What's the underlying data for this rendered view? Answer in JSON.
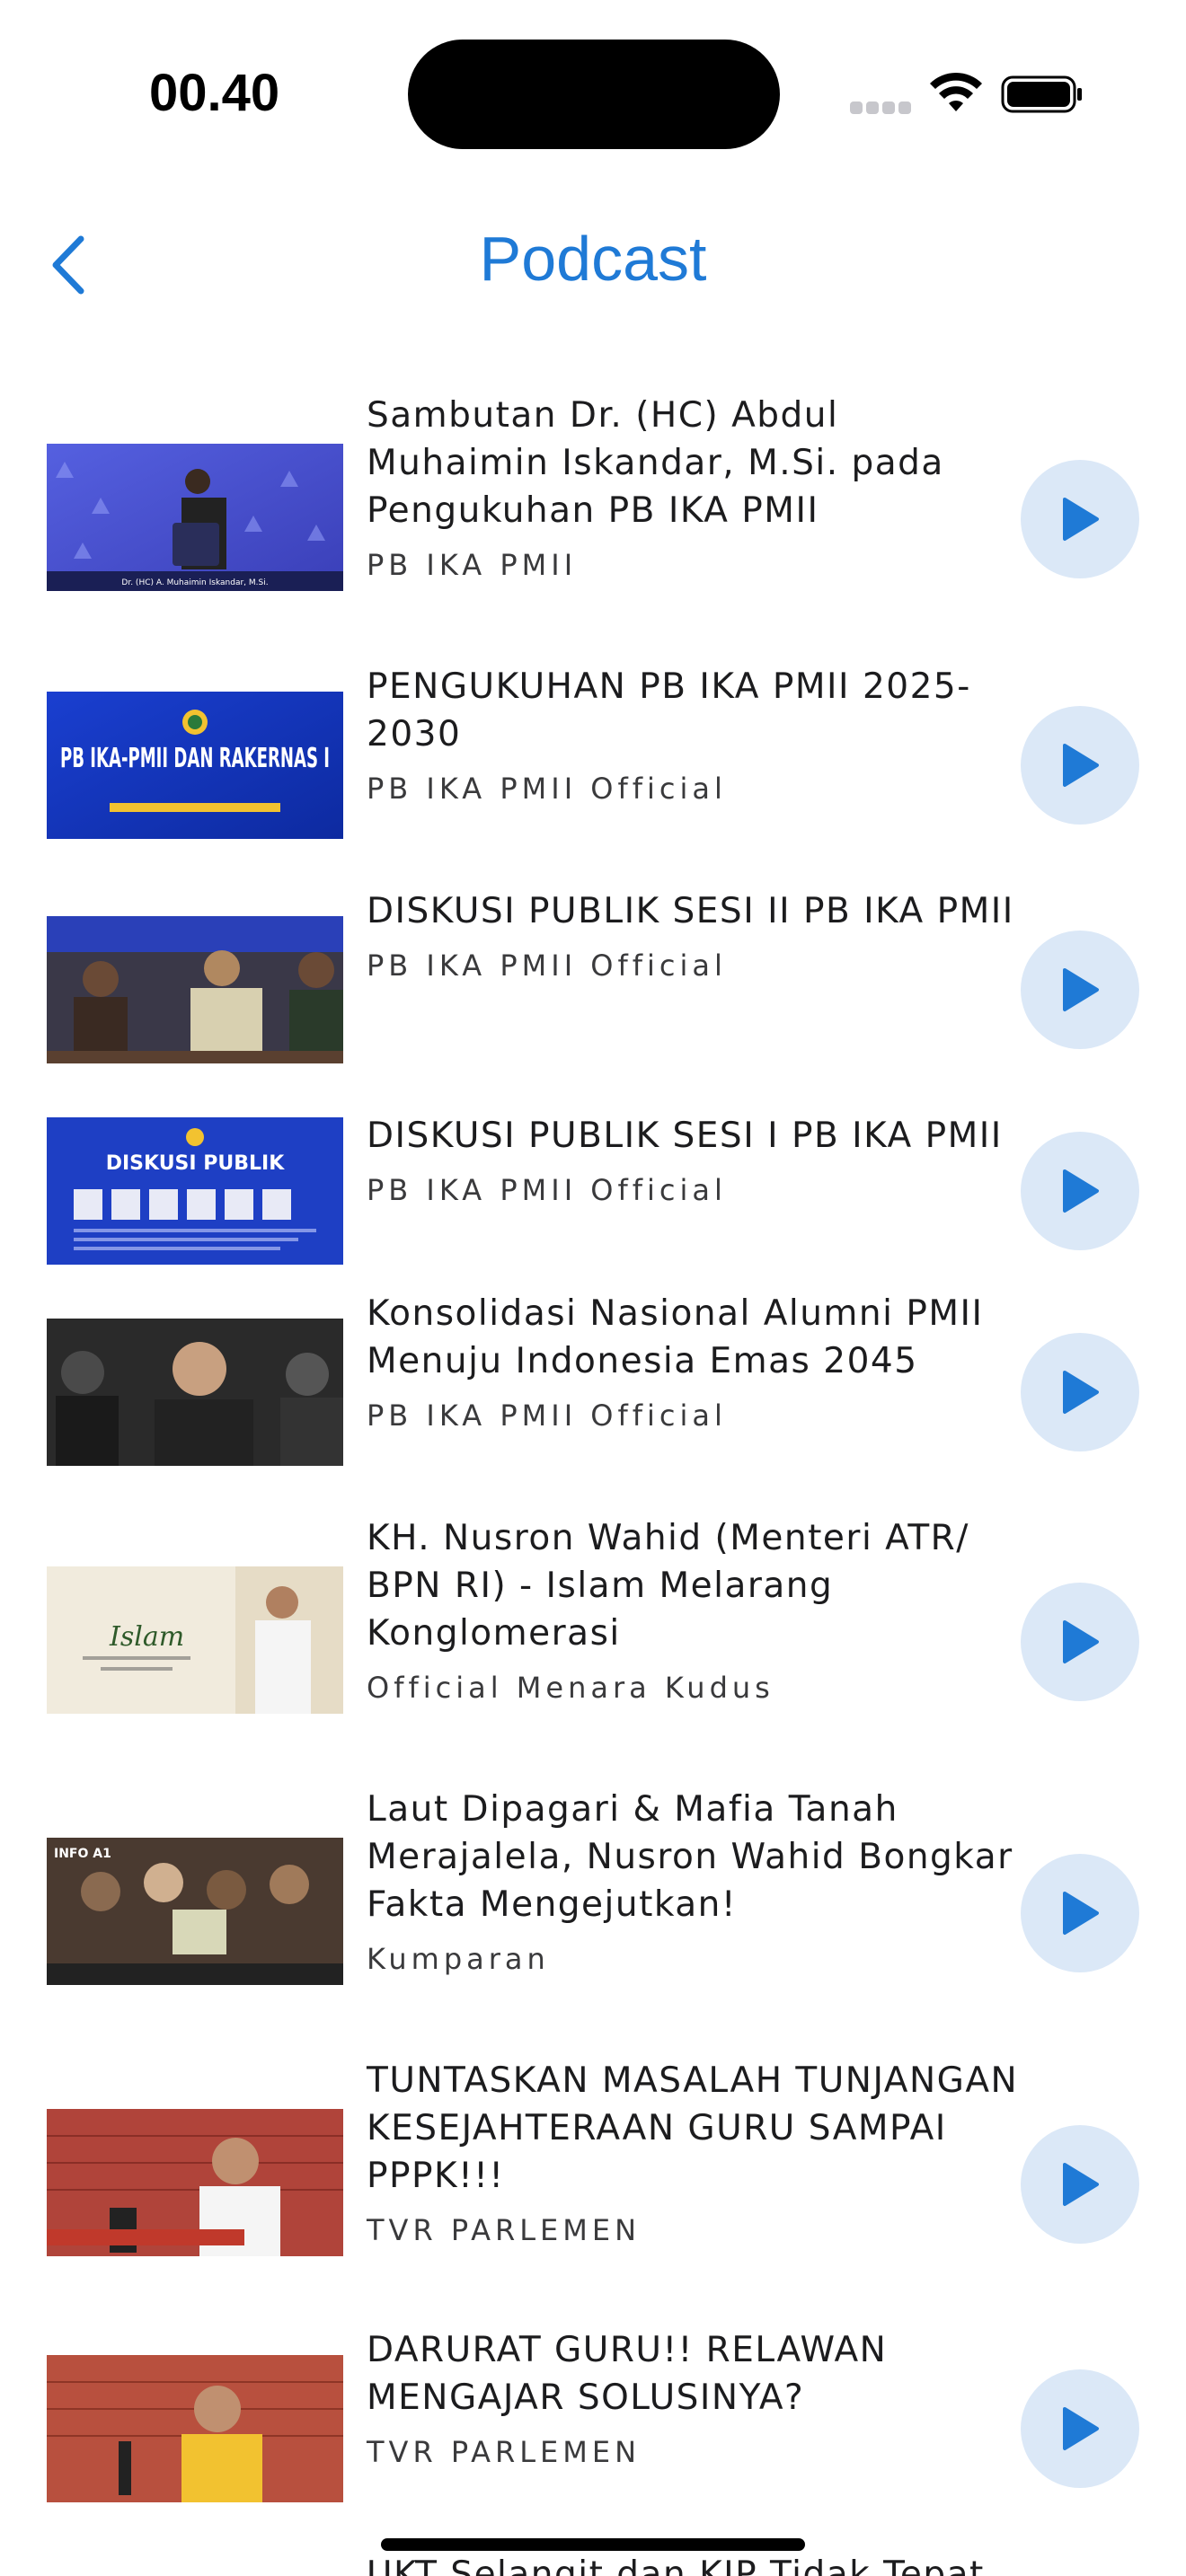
{
  "status_bar": {
    "time": "00.40"
  },
  "nav": {
    "title": "Podcast"
  },
  "colors": {
    "accent": "#1f7ad6",
    "play_bg": "#dbe8f7"
  },
  "icons": {
    "back": "chevron-left-icon",
    "play": "play-icon",
    "wifi": "wifi-icon",
    "battery": "battery-icon",
    "signal": "cellular-signal-icon"
  },
  "podcasts": [
    {
      "title": "Sambutan Dr. (HC) Abdul Muhaimin Iskandar, M.Si. pada Pengukuhan PB IKA PMII",
      "channel": "PB IKA PMII",
      "thumb_overlay": "Dr. (HC) A. Muhaimin Iskandar, M.Si."
    },
    {
      "title": "PENGUKUHAN PB IKA PMII 2025-2030",
      "channel": "PB IKA PMII Official",
      "thumb_overlay": "PB IKA-PMII DAN RAKERNAS I"
    },
    {
      "title": "DISKUSI PUBLIK SESI II PB IKA PMII",
      "channel": "PB IKA PMII Official",
      "thumb_overlay": ""
    },
    {
      "title": "DISKUSI PUBLIK SESI I PB IKA PMII",
      "channel": "PB IKA PMII Official",
      "thumb_overlay": "DISKUSI PUBLIK"
    },
    {
      "title": "Konsolidasi Nasional Alumni PMII Menuju Indonesia Emas 2045",
      "channel": "PB IKA PMII Official",
      "thumb_overlay": ""
    },
    {
      "title": "KH. Nusron Wahid (Menteri ATR/ BPN RI) - Islam Melarang Konglomerasi",
      "channel": "Official Menara Kudus",
      "thumb_overlay": "Islam"
    },
    {
      "title": "Laut Dipagari & Mafia Tanah Merajalela, Nusron Wahid Bongkar Fakta Mengejutkan!",
      "channel": "Kumparan",
      "thumb_overlay": "INFO A1"
    },
    {
      "title": "TUNTASKAN MASALAH TUNJANGAN KESEJAHTERAAN GURU SAMPAI PPPK!!!",
      "channel": "TVR PARLEMEN",
      "thumb_overlay": ""
    },
    {
      "title": "DARURAT GURU!! RELAWAN MENGAJAR SOLUSINYA?",
      "channel": "TVR PARLEMEN",
      "thumb_overlay": ""
    },
    {
      "title": "UKT Selangit dan KIP Tidak Tepat",
      "channel": "",
      "thumb_overlay": ""
    }
  ]
}
